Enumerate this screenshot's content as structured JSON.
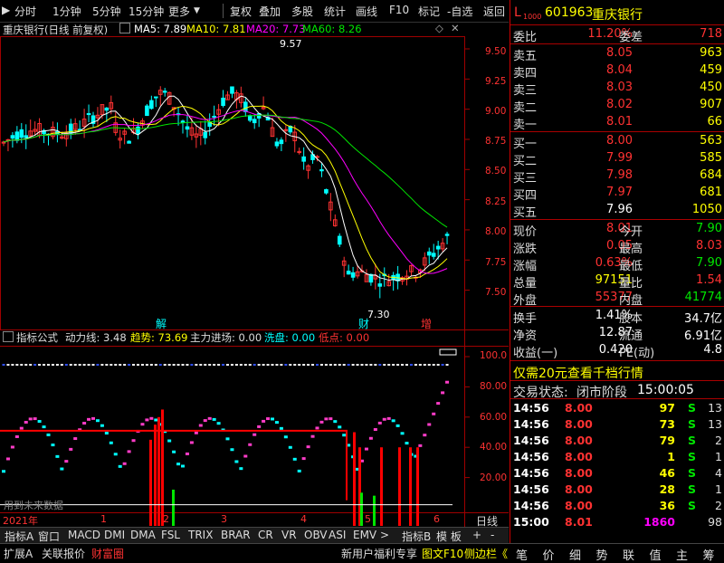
{
  "toolbar": {
    "left_items": [
      "分时",
      "1分钟",
      "5分钟",
      "15分钟",
      "更多"
    ],
    "right_items": [
      "复权",
      "叠加",
      "多股",
      "统计",
      "画线",
      "F10",
      "标记",
      "-自选",
      "返回"
    ]
  },
  "chart_header": {
    "title": "重庆银行(日线 前复权)",
    "ma5": "MA5: 7.89",
    "ma10": "MA10: 7.81",
    "ma20": "MA20: 7.73",
    "ma60": "MA60: 8.26"
  },
  "price_axis": {
    "ticks": [
      "9.50",
      "9.25",
      "9.00",
      "8.75",
      "8.50",
      "8.25",
      "8.00",
      "7.75",
      "7.50"
    ]
  },
  "annotations": {
    "high_label": "9.57",
    "low_label": "7.30",
    "mark_jie": "解",
    "mark_cai": "财",
    "mark_zeng": "增"
  },
  "indicator_header": {
    "name": "指标公式",
    "l1": "动力线: 3.48",
    "l2": "趋势: 73.69",
    "l3": "主力进场: 0.00",
    "l4": "洗盘: 0.00",
    "l5": "低点: 0.00"
  },
  "indicator_axis": {
    "ticks": [
      "100.0",
      "80.00",
      "60.00",
      "40.00",
      "20.00"
    ]
  },
  "indicator_watermark": "用到未来数据",
  "time_axis": {
    "year": "2021年",
    "months": [
      "1",
      "2",
      "3",
      "4",
      "5",
      "6"
    ],
    "label": "日线"
  },
  "tabs": [
    "指标A",
    "窗口",
    "MACD",
    "DMI",
    "DMA",
    "FSL",
    "TRIX",
    "BRAR",
    "CR",
    "VR",
    "OBV",
    "ASI",
    "EMV",
    ">",
    "指标B",
    "模 板",
    "+",
    "-"
  ],
  "status_bar": {
    "left": [
      "扩展A",
      "关联报价",
      "财富圈"
    ],
    "promo": "新用户福利专享",
    "f10": "图文F10",
    "sidebar": "侧边栏《"
  },
  "quote": {
    "flag": "L",
    "sub": "1000",
    "code": "601963",
    "name": "重庆银行",
    "weibi_label": "委比",
    "weibi": "11.20%",
    "weicha_label": "委差",
    "weicha": "718",
    "asks": [
      {
        "label": "卖五",
        "price": "8.05",
        "vol": "963"
      },
      {
        "label": "卖四",
        "price": "8.04",
        "vol": "459"
      },
      {
        "label": "卖三",
        "price": "8.03",
        "vol": "450"
      },
      {
        "label": "卖二",
        "price": "8.02",
        "vol": "907"
      },
      {
        "label": "卖一",
        "price": "8.01",
        "vol": "66"
      }
    ],
    "bids": [
      {
        "label": "买一",
        "price": "8.00",
        "vol": "563"
      },
      {
        "label": "买二",
        "price": "7.99",
        "vol": "585"
      },
      {
        "label": "买三",
        "price": "7.98",
        "vol": "684"
      },
      {
        "label": "买四",
        "price": "7.97",
        "vol": "681"
      },
      {
        "label": "买五",
        "price": "7.96",
        "vol": "1050"
      }
    ],
    "stats": [
      {
        "l1": "现价",
        "v1": "8.01",
        "c1": "red",
        "l2": "今开",
        "v2": "7.90",
        "c2": "green"
      },
      {
        "l1": "涨跌",
        "v1": "0.05",
        "c1": "red",
        "l2": "最高",
        "v2": "8.03",
        "c2": "red"
      },
      {
        "l1": "涨幅",
        "v1": "0.63%",
        "c1": "red",
        "l2": "最低",
        "v2": "7.90",
        "c2": "green"
      },
      {
        "l1": "总量",
        "v1": "97151",
        "c1": "yellow",
        "l2": "量比",
        "v2": "1.54",
        "c2": "red"
      },
      {
        "l1": "外盘",
        "v1": "55377",
        "c1": "red",
        "l2": "内盘",
        "v2": "41774",
        "c2": "green"
      }
    ],
    "stats2": [
      {
        "l1": "换手",
        "v1": "1.41%",
        "l2": "股本",
        "v2": "34.7亿"
      },
      {
        "l1": "净资",
        "v1": "12.87",
        "l2": "流通",
        "v2": "6.91亿"
      },
      {
        "l1": "收益(一)",
        "v1": "0.420",
        "l2": "PE(动)",
        "v2": "4.8"
      }
    ],
    "promo": "仅需20元查看千档行情",
    "trade_state_label": "交易状态:",
    "trade_state": "闭市阶段",
    "trade_time": "15:00:05",
    "ticks": [
      {
        "t": "14:56",
        "p": "8.00",
        "v": "97",
        "d": "S",
        "n": "13"
      },
      {
        "t": "14:56",
        "p": "8.00",
        "v": "73",
        "d": "S",
        "n": "13"
      },
      {
        "t": "14:56",
        "p": "8.00",
        "v": "79",
        "d": "S",
        "n": "2"
      },
      {
        "t": "14:56",
        "p": "8.00",
        "v": "1",
        "d": "S",
        "n": "1"
      },
      {
        "t": "14:56",
        "p": "8.00",
        "v": "46",
        "d": "S",
        "n": "4"
      },
      {
        "t": "14:56",
        "p": "8.00",
        "v": "28",
        "d": "S",
        "n": "1"
      },
      {
        "t": "14:56",
        "p": "8.00",
        "v": "36",
        "d": "S",
        "n": "2"
      },
      {
        "t": "15:00",
        "p": "8.01",
        "v": "1860",
        "d": "",
        "n": "98"
      }
    ],
    "bottom_tabs": [
      "笔",
      "价",
      "细",
      "势",
      "联",
      "值",
      "主",
      "筹"
    ]
  },
  "colors": {
    "up": "#ff3232",
    "down": "#00ffff",
    "ma5": "#ffffff",
    "ma10": "#ffff00",
    "ma20": "#ff00ff",
    "ma60": "#00e600",
    "grid": "#a00000"
  }
}
